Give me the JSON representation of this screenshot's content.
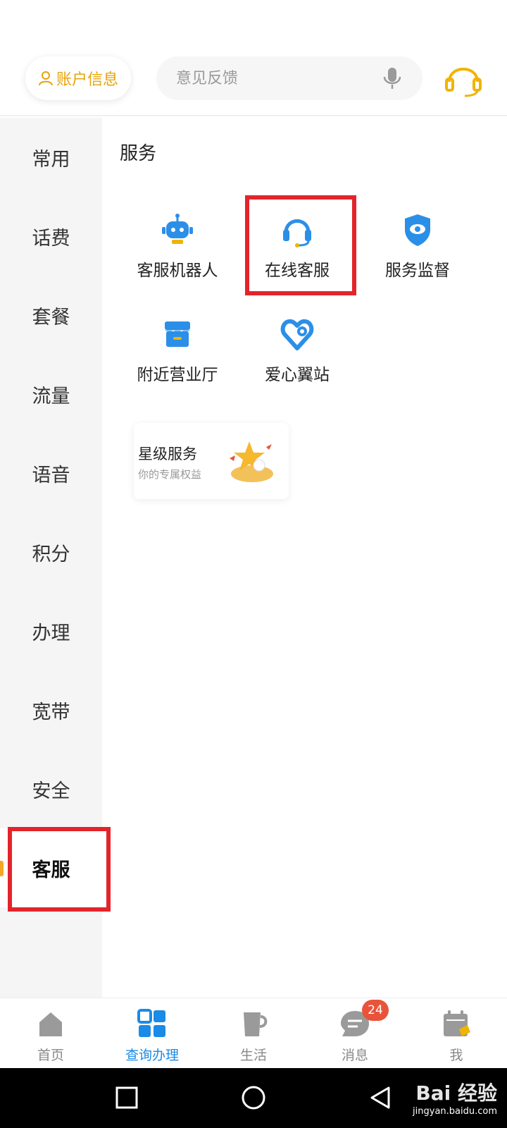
{
  "header": {
    "account_label": "账户信息",
    "search_placeholder": "意见反馈"
  },
  "sidebar": {
    "items": [
      {
        "label": "常用"
      },
      {
        "label": "话费"
      },
      {
        "label": "套餐"
      },
      {
        "label": "流量"
      },
      {
        "label": "语音"
      },
      {
        "label": "积分"
      },
      {
        "label": "办理"
      },
      {
        "label": "宽带"
      },
      {
        "label": "安全"
      },
      {
        "label": "客服"
      }
    ],
    "active_index": 9
  },
  "content": {
    "section_title": "服务",
    "services": [
      {
        "label": "客服机器人",
        "icon": "robot-icon"
      },
      {
        "label": "在线客服",
        "icon": "headset-icon"
      },
      {
        "label": "服务监督",
        "icon": "shield-eye-icon"
      },
      {
        "label": "附近营业厅",
        "icon": "store-icon"
      },
      {
        "label": "爱心翼站",
        "icon": "heart-location-icon"
      }
    ],
    "star_card": {
      "title": "星级服务",
      "subtitle": "你的专属权益"
    }
  },
  "bottom_nav": {
    "items": [
      {
        "label": "首页",
        "icon": "home-icon"
      },
      {
        "label": "查询办理",
        "icon": "grid-icon"
      },
      {
        "label": "生活",
        "icon": "cup-icon"
      },
      {
        "label": "消息",
        "icon": "chat-icon",
        "badge": "24"
      },
      {
        "label": "我",
        "icon": "calendar-sign-icon"
      }
    ],
    "active_index": 1
  },
  "watermark": {
    "brand": "Bai 经验",
    "url": "jingyan.baidu.com"
  },
  "colors": {
    "accent_yellow": "#e7a30a",
    "accent_blue": "#1a8be6",
    "highlight_red": "#e3242b"
  }
}
